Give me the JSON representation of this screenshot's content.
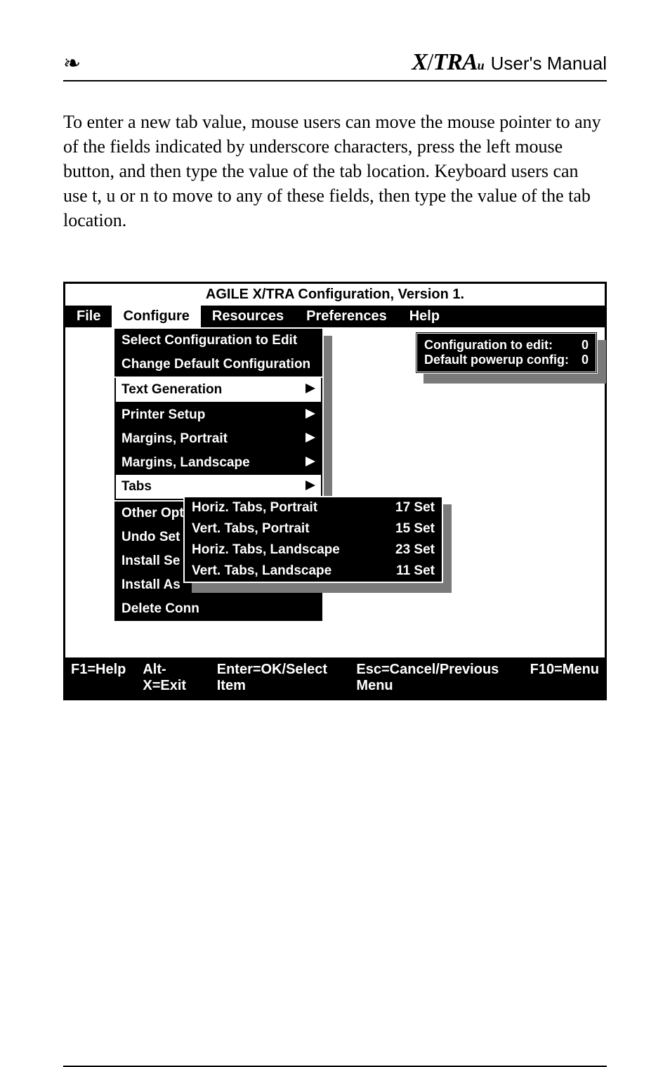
{
  "header": {
    "logo_glyph": "❧",
    "product_name_html": "X/TRA",
    "suffix": "User's Manual"
  },
  "body_paragraph": "To enter a new tab value, mouse users can move the mouse pointer to any of the fields indicated by underscore characters, press the left mouse button, and then type the value of the tab location. Keyboard users can use t, u or n to move to any of these fields, then type the value of the tab location.",
  "app": {
    "title": "AGILE X/TRA Configuration, Version 1.",
    "menu": {
      "file": "File",
      "configure": "Configure",
      "resources": "Resources",
      "preferences": "Preferences",
      "help": "Help"
    },
    "configure_menu": {
      "select_config": "Select Configuration to Edit",
      "change_default": "Change Default Configuration",
      "text_generation": "Text Generation",
      "printer_setup": "Printer Setup",
      "margins_portrait": "Margins, Portrait",
      "margins_landscape": "Margins, Landscape",
      "tabs": "Tabs",
      "other_opt": "Other Opt",
      "undo_set": "Undo Set",
      "install_se": "Install Se",
      "install_as": "Install As",
      "delete_con": "Delete Conn"
    },
    "tabs_submenu": {
      "items": [
        {
          "label": "Horiz. Tabs, Portrait",
          "value": "17 Set"
        },
        {
          "label": "Vert. Tabs, Portrait",
          "value": "15 Set"
        },
        {
          "label": "Horiz. Tabs, Landscape",
          "value": "23 Set"
        },
        {
          "label": "Vert. Tabs, Landscape",
          "value": "11 Set"
        }
      ]
    },
    "infobox": {
      "row1_label": "Configuration to edit:",
      "row1_value": "0",
      "row2_label": "Default powerup config:",
      "row2_value": "0"
    },
    "status": {
      "f1": "F1=Help",
      "altx": "Alt-X=Exit",
      "enter": "Enter=OK/Select Item",
      "esc": "Esc=Cancel/Previous Menu",
      "f10": "F10=Menu"
    }
  }
}
